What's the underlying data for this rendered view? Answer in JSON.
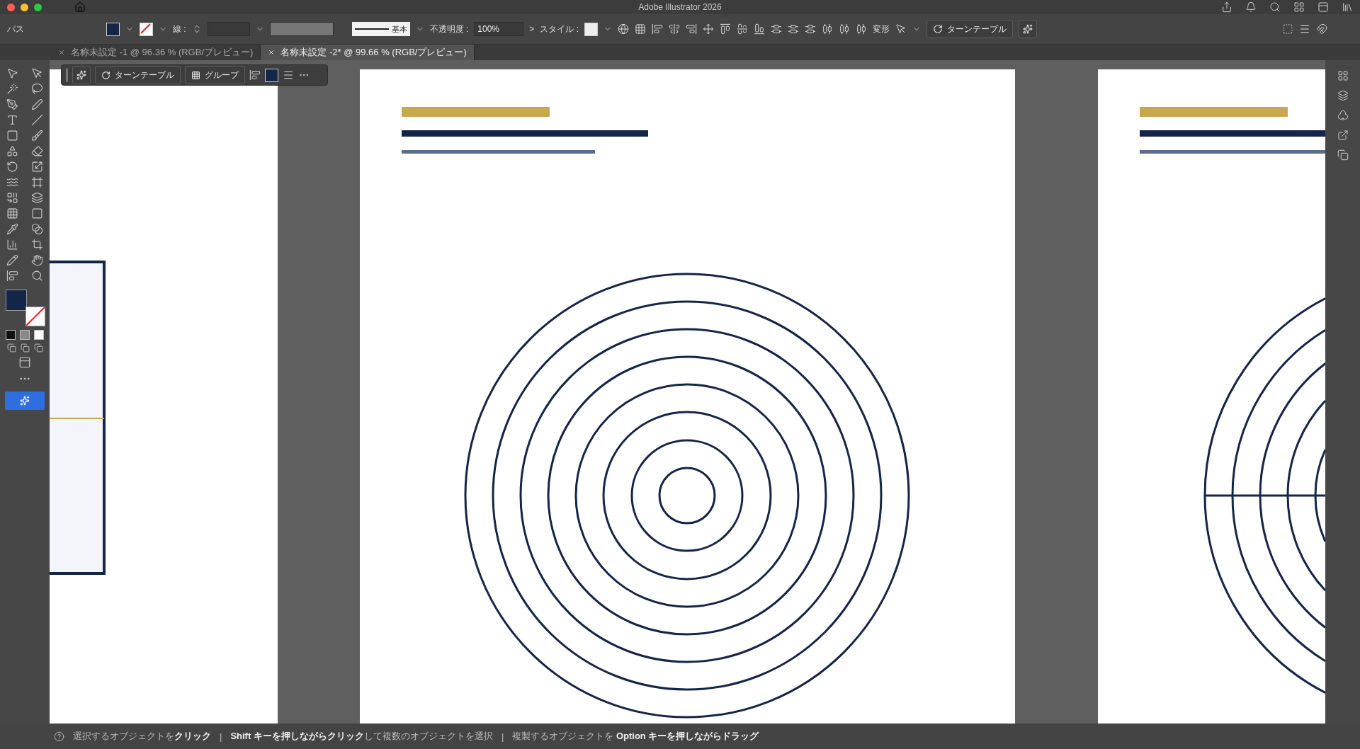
{
  "window": {
    "title": "Adobe Illustrator 2026"
  },
  "control_bar": {
    "selection_label": "パス",
    "stroke_label": "線 :",
    "stroke_profile": "基本",
    "opacity_label": "不透明度 :",
    "opacity_value": "100%",
    "opacity_arrow": ">",
    "style_label": "スタイル :",
    "transform_label": "変形",
    "turntable_button": "ターンテーブル"
  },
  "tabs": [
    {
      "label": "名称未設定 -1 @ 96.36 % (RGB/プレビュー)",
      "selected": false
    },
    {
      "label": "名称未設定 -2* @ 99.66 % (RGB/プレビュー)",
      "selected": true
    }
  ],
  "context_bar": {
    "buttons": [
      "ターンテーブル",
      "グループ"
    ]
  },
  "status_bar": {
    "separator": "|",
    "segments": [
      "選択するオブジェクトを**クリック**",
      "**Shift キーを押しながらクリック**して複数のオブジェクトを選択",
      "複製するオブジェクトを **Option キーを押しながらドラッグ**"
    ]
  }
}
